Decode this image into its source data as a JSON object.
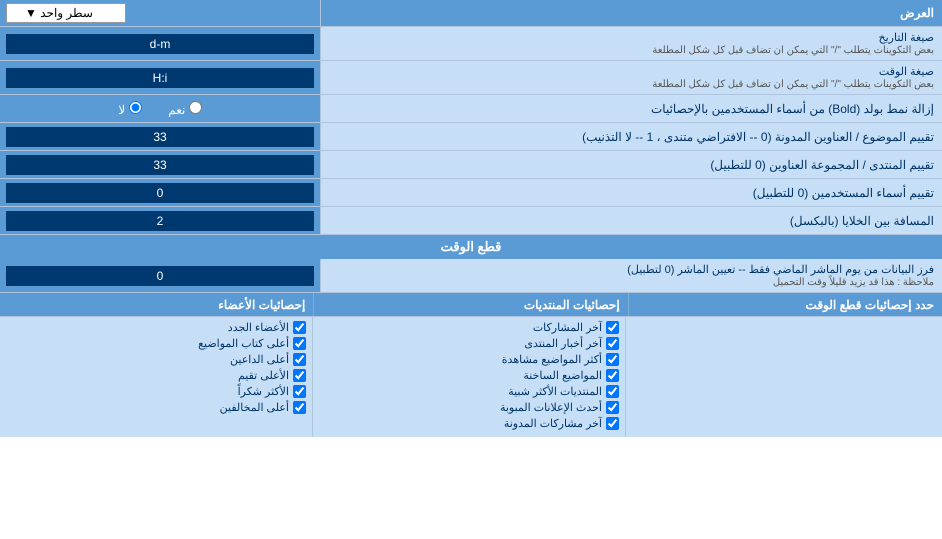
{
  "header": {
    "label_ard": "العرض",
    "dropdown_label": "سطر واحد"
  },
  "rows": [
    {
      "id": "date_format",
      "label": "صيغة التاريخ\nبعض التكوينات يتطلب \"/\" التي يمكن ان تضاف قبل كل شكل المطلعة",
      "input_value": "d-m"
    },
    {
      "id": "time_format",
      "label": "صيغة الوقت\nبعض التكوينات يتطلب \"/\" التي يمكن ان تضاف قبل كل شكل المطلعة",
      "input_value": "H:i"
    },
    {
      "id": "bold_remove",
      "label": "إزالة نمط بولد (Bold) من أسماء المستخدمين بالإحصائيات",
      "radio_yes": "نعم",
      "radio_no": "لا",
      "radio_selected": "no"
    },
    {
      "id": "topic_order",
      "label": "تقييم الموضوع / العناوين المدونة (0 -- الافتراضي متندى ، 1 -- لا التذنيب)",
      "input_value": "33"
    },
    {
      "id": "forum_order",
      "label": "تقييم المنتدى / المجموعة العناوين (0 للتطبيل)",
      "input_value": "33"
    },
    {
      "id": "users_order",
      "label": "تقييم أسماء المستخدمين (0 للتطبيل)",
      "input_value": "0"
    },
    {
      "id": "distance",
      "label": "المسافة بين الخلايا (بالبكسل)",
      "input_value": "2"
    }
  ],
  "section_cutoff": {
    "title": "قطع الوقت",
    "label": "فرز البيانات من يوم الماشر الماضي فقط -- تعيين الماشر (0 لتطبيل)\nملاحظة : هذا قد يزيد قليلاً وقت التحميل",
    "input_value": "0"
  },
  "bottom": {
    "limit_label": "حدد إحصائيات قطع الوقت",
    "col1_header": "إحصائيات المنتديات",
    "col2_header": "إحصائيات الأعضاء",
    "col1_items": [
      "آخر المشاركات",
      "آخر أخبار المنتدى",
      "أكثر المواضيع مشاهدة",
      "المواضيع الساخنة",
      "المنتديات الأكثر شبية",
      "أحدث الإعلانات المبوبة",
      "آخر مشاركات المدونة"
    ],
    "col2_items": [
      "الأعضاء الجدد",
      "أعلى كتاب المواضيع",
      "أعلى الداعين",
      "الأعلى تقيم",
      "الأكثر شكراً",
      "أعلى المخالفين"
    ]
  }
}
